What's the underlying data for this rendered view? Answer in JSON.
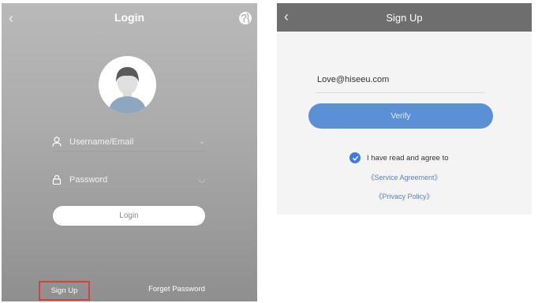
{
  "login": {
    "title": "Login",
    "username_placeholder": "Username/Email",
    "password_placeholder": "Password",
    "login_button": "Login",
    "signup_link": "Sign Up",
    "forget_link": "Forget Password",
    "icons": {
      "back": "chevron-left-icon",
      "globe": "globe-icon",
      "avatar": "user-avatar",
      "user": "user-icon",
      "lock": "lock-icon"
    }
  },
  "signup": {
    "title": "Sign Up",
    "email_value": "Love@hiseeu.com",
    "verify_button": "Verify",
    "agree_text": "I have read and agree to",
    "service_link": "《Service Agreement》",
    "privacy_link": "《Privacy Policy》",
    "icons": {
      "back": "chevron-left-icon",
      "check": "checkmark-circle-icon"
    }
  },
  "colors": {
    "accent_blue": "#5b8fd6",
    "highlight_red": "#d94040",
    "header_gray": "#6e6e6e"
  }
}
